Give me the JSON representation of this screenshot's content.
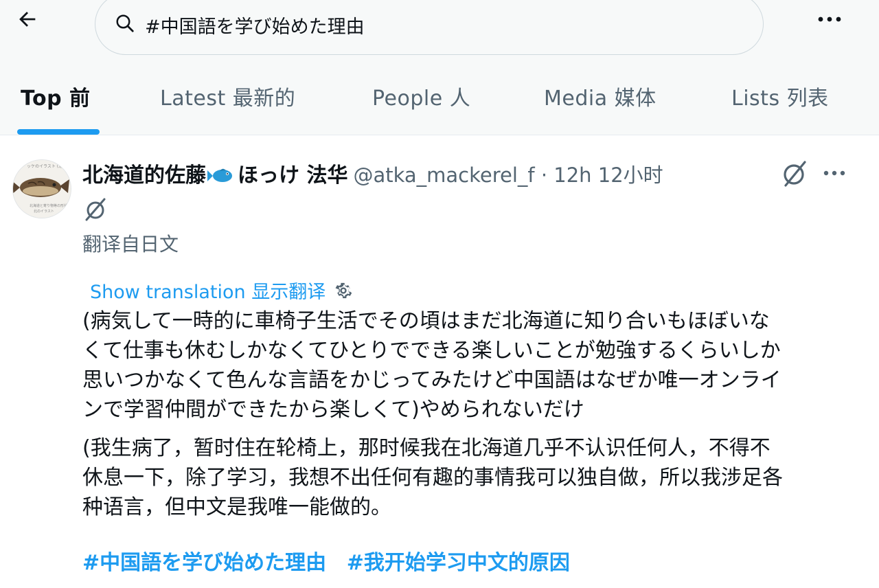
{
  "search": {
    "query": "#中国語を学び始めた理由"
  },
  "tabs": [
    {
      "label": "Top  前"
    },
    {
      "label": "Latest  最新的"
    },
    {
      "label": "People  人"
    },
    {
      "label": "Media  媒体"
    },
    {
      "label": "Lists  列表"
    }
  ],
  "tweet": {
    "author_name": "北海道的佐藤",
    "author_name_suffix": "ほっけ 法华",
    "handle_time": "@atka_mackerel_f · 12h 12小时",
    "translated_label": "翻译自日文",
    "show_translation": "Show translation 显示翻译",
    "original_lines": [
      "(病気して一時的に車椅子生活でその頃はまだ北海道に知り合いもほぼいな",
      "くて仕事も休むしかなくてひとりでできる楽しいことが勉強するくらいしか",
      "思いつかなくて色んな言語をかじってみたけど中国語はなぜか唯一オンライ",
      "ンで学習仲間ができたから楽しくて)やめられないだけ"
    ],
    "translation_lines": [
      "(我生病了，暂时住在轮椅上，那时候我在北海道几乎不认识任何人，不得不",
      "休息一下，除了学习，我想不出任何有趣的事情我可以独自做，所以我涉足各",
      "种语言，但中文是我唯一能做的。"
    ],
    "hashtags": [
      "#中国語を学び始めた理由",
      "#我开始学习中文的原因"
    ],
    "avatar_caption": [
      "ッケのイラスト (北",
      "北海道と寄り物等の形状",
      "北のイラスト"
    ]
  },
  "colors": {
    "accent": "#1d9bf0",
    "muted": "#536471",
    "text": "#0f1419"
  },
  "icons": [
    "back-arrow-icon",
    "search-icon",
    "more-icon",
    "fish-emoji-icon",
    "translate-badge-icon",
    "gear-icon"
  ]
}
